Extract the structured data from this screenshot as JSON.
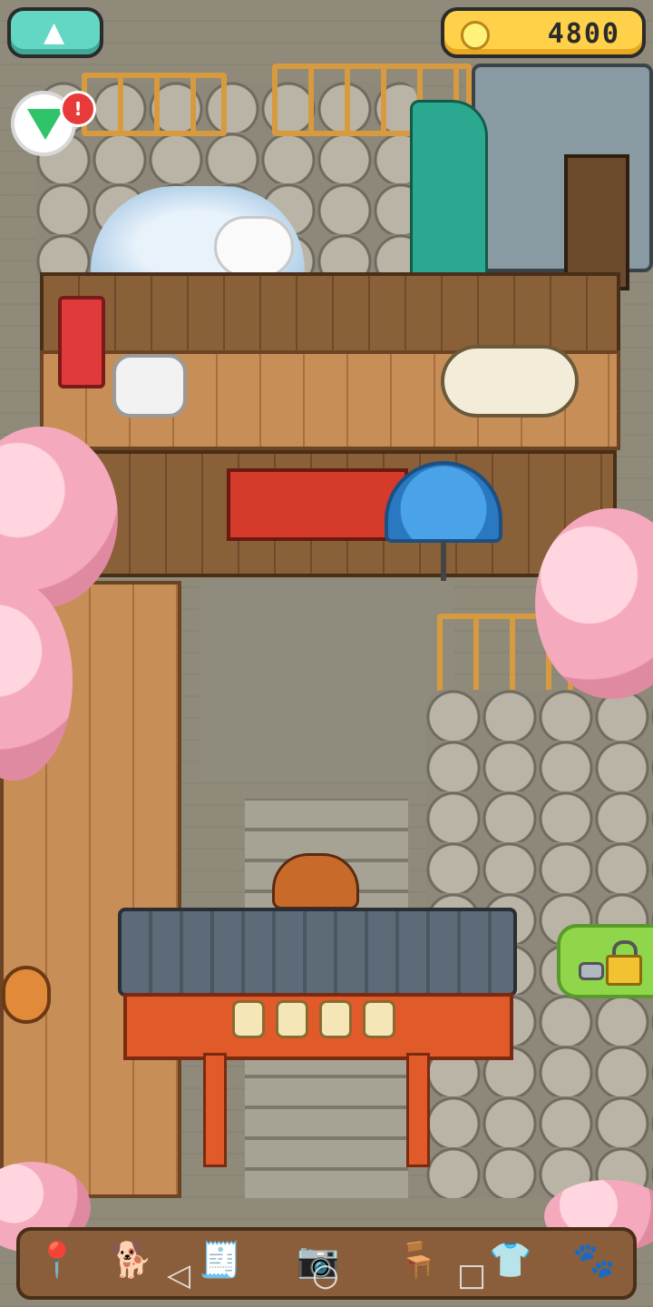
{
  "hud": {
    "coins": "4800",
    "notification_count": "!",
    "colors": {
      "coin_pill": "#ffd04a",
      "menu_pill": "#63d6c4",
      "gem": "#2fc46a",
      "badge": "#e83a3a",
      "lock_button": "#8fd64a"
    }
  },
  "toolbar": {
    "items": [
      {
        "name": "map-pin-icon",
        "glyph": "📍"
      },
      {
        "name": "dog-face-icon",
        "glyph": "🐕"
      },
      {
        "name": "cash-register-icon",
        "glyph": "🧾"
      },
      {
        "name": "camera-icon",
        "glyph": "📷"
      },
      {
        "name": "armchair-icon",
        "glyph": "🪑"
      },
      {
        "name": "shirt-icon",
        "glyph": "👕"
      },
      {
        "name": "paw-icon",
        "glyph": "🐾"
      }
    ]
  },
  "android_nav": {
    "back": "◁",
    "home": "○",
    "recents": "□"
  }
}
